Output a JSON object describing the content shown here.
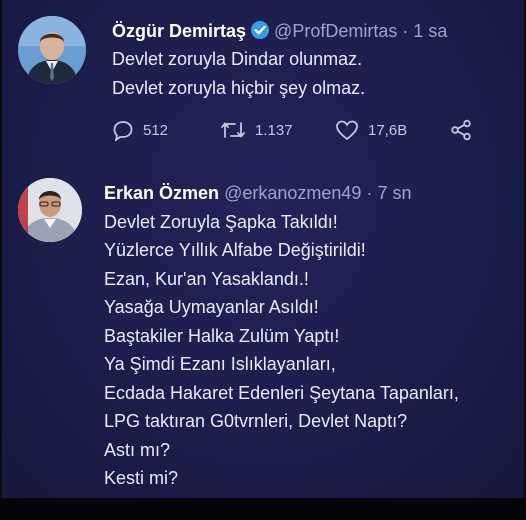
{
  "tweet1": {
    "display_name": "Özgür Demirtaş",
    "handle": "@ProfDemirtas",
    "separator": "·",
    "time": "1 sa",
    "lines": [
      "Devlet zoruyla Dindar olunmaz.",
      "Devlet zoruyla hiçbir şey olmaz."
    ],
    "replies": "512",
    "retweets": "1.137",
    "likes": "17,6B",
    "icons": {
      "reply": "reply-icon",
      "retweet": "retweet-icon",
      "like": "like-icon",
      "share": "share-icon",
      "verified": "verified-badge-icon"
    }
  },
  "tweet2": {
    "display_name": "Erkan Özmen",
    "handle": "@erkanozmen49",
    "separator": "·",
    "time": "7 sn",
    "lines": [
      "Devlet Zoruyla Şapka Takıldı!",
      "Yüzlerce Yıllık Alfabe Değiştirildi!",
      "Ezan, Kur'an Yasaklandı.!",
      "Yasağa Uymayanlar Asıldı!",
      "Baştakiler Halka Zulüm Yaptı!",
      "Ya Şimdi Ezanı Islıklayanları,",
      "Ecdada Hakaret Edenleri Şeytana Tapanları,",
      "LPG taktıran G0tvrnleri, Devlet Naptı?",
      "Astı mı?",
      "Kesti mi?"
    ]
  },
  "colors": {
    "background": "#1b1d4a",
    "text": "#e9ebf7",
    "muted": "#9ea3c9",
    "verified": "#3a9bea"
  }
}
